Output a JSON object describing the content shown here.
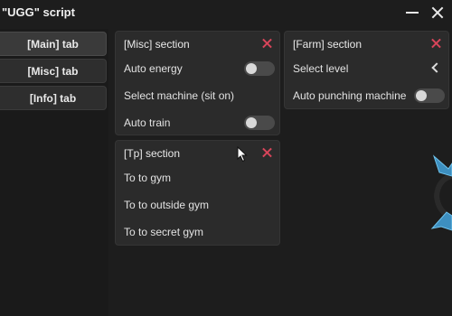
{
  "window": {
    "title": "\"UGG\" script"
  },
  "tabs": [
    {
      "label": "[Main] tab",
      "active": true
    },
    {
      "label": "[Misc] tab",
      "active": false
    },
    {
      "label": "[Info] tab",
      "active": false
    }
  ],
  "misc_section": {
    "title": "[Misc] section",
    "items": [
      {
        "label": "Auto energy",
        "type": "toggle",
        "on": false
      },
      {
        "label": "Select machine (sit on)",
        "type": "button"
      },
      {
        "label": "Auto train",
        "type": "toggle",
        "on": false
      }
    ]
  },
  "farm_section": {
    "title": "[Farm] section",
    "items": [
      {
        "label": "Select level",
        "type": "dropdown"
      },
      {
        "label": "Auto punching machine",
        "type": "toggle",
        "on": false
      }
    ]
  },
  "tp_section": {
    "title": "[Tp] section",
    "items": [
      {
        "label": "To to gym",
        "type": "button"
      },
      {
        "label": "To to outside gym",
        "type": "button"
      },
      {
        "label": "To to secret gym",
        "type": "button"
      }
    ]
  },
  "colors": {
    "background": "#1d1d1d",
    "panel": "#2b2b2b",
    "close_accent": "#d8455a",
    "toggle_track": "#4a4a4a",
    "decor_blue": "#4fa9d8"
  }
}
